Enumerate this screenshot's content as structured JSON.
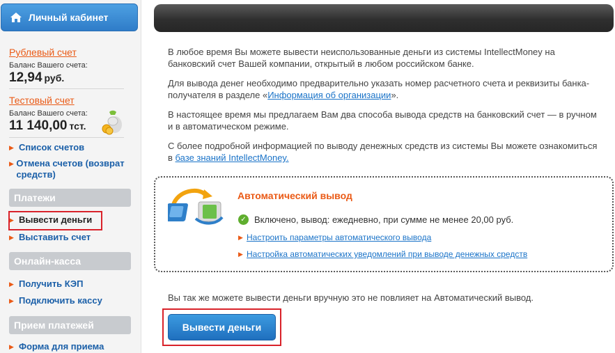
{
  "sidebar": {
    "header": "Личный кабинет",
    "accounts": [
      {
        "name": "Рублевый счет",
        "balance_label": "Баланс Вашего счета:",
        "balance": "12,94",
        "currency": "руб."
      },
      {
        "name": "Тестовый счет",
        "balance_label": "Баланс Вашего счета:",
        "balance": "11 140,00",
        "currency": "тст."
      }
    ],
    "links": [
      "Список счетов",
      "Отмена счетов (возврат средств)"
    ],
    "sections": [
      {
        "title": "Платежи",
        "items": [
          "Вывести деньги",
          "Выставить счет"
        ]
      },
      {
        "title": "Онлайн-касса",
        "items": [
          "Получить КЭП",
          "Подключить кассу"
        ]
      },
      {
        "title": "Прием платежей",
        "items": [
          "Форма для приема"
        ]
      }
    ],
    "active_item": "Вывести деньги"
  },
  "main": {
    "p1": "В любое время Вы можете вывести неиспользованные деньги из системы IntellectMoney на банковский счет Вашей компании, открытый в любом российском банке.",
    "p2_before": "Для вывода денег необходимо предварительно указать номер расчетного счета и реквизиты банка-получателя в разделе «",
    "p2_link": "Информация об организации",
    "p2_after": "».",
    "p3": "В настоящее время мы предлагаем Вам два способа вывода средств на банковский счет — в ручном и в автоматическом режиме.",
    "p4_before": "С более подробной информацией по выводу денежных средств из системы Вы можете ознакомиться в ",
    "p4_link": "базе знаний IntellectMoney.",
    "auto": {
      "title": "Автоматический вывод",
      "status": "Включено, вывод: ежедневно, при сумме не менее 20,00 руб.",
      "link1": "Настроить параметры автоматического вывода",
      "link2": "Настройка автоматических уведомлений при выводе денежных средств"
    },
    "manual_text": "Вы так же можете вывести деньги вручную это не повлияет на Автоматический вывод.",
    "withdraw_button": "Вывести деньги"
  },
  "colors": {
    "accent": "#ea5a16",
    "link": "#1a73c8",
    "highlight": "#d9222a"
  }
}
